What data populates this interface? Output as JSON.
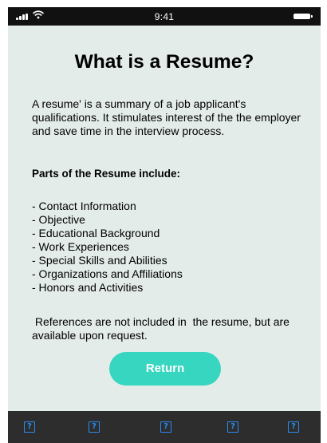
{
  "status_bar": {
    "time": "9:41",
    "icons": [
      "signal-icon",
      "wifi-icon",
      "battery-icon"
    ]
  },
  "content": {
    "title": "What is a Resume?",
    "intro": "A resume' is a summary of a job applicant's qualifications. It stimulates interest of the the employer and save time in the interview process.",
    "parts_heading": "Parts of the Resume include:",
    "parts": [
      "- Contact Information",
      "- Objective",
      "- Educational Background",
      "- Work Experiences",
      "- Special Skills and Abilities",
      "- Organizations and Affiliations",
      "- Honors and Activities"
    ],
    "references": " References are not included in  the resume, but are available upon request."
  },
  "return_button": {
    "label": "Return"
  },
  "tab_bar": {
    "icon_glyph": "?",
    "icons": [
      "question-icon",
      "question-icon",
      "question-icon",
      "question-icon",
      "question-icon"
    ]
  },
  "colors": {
    "background": "#e4ecea",
    "status_bar": "#111111",
    "accent": "#36d6c0",
    "tab_bar": "#2d2d2d",
    "tab_icon": "#2b8bf1"
  }
}
